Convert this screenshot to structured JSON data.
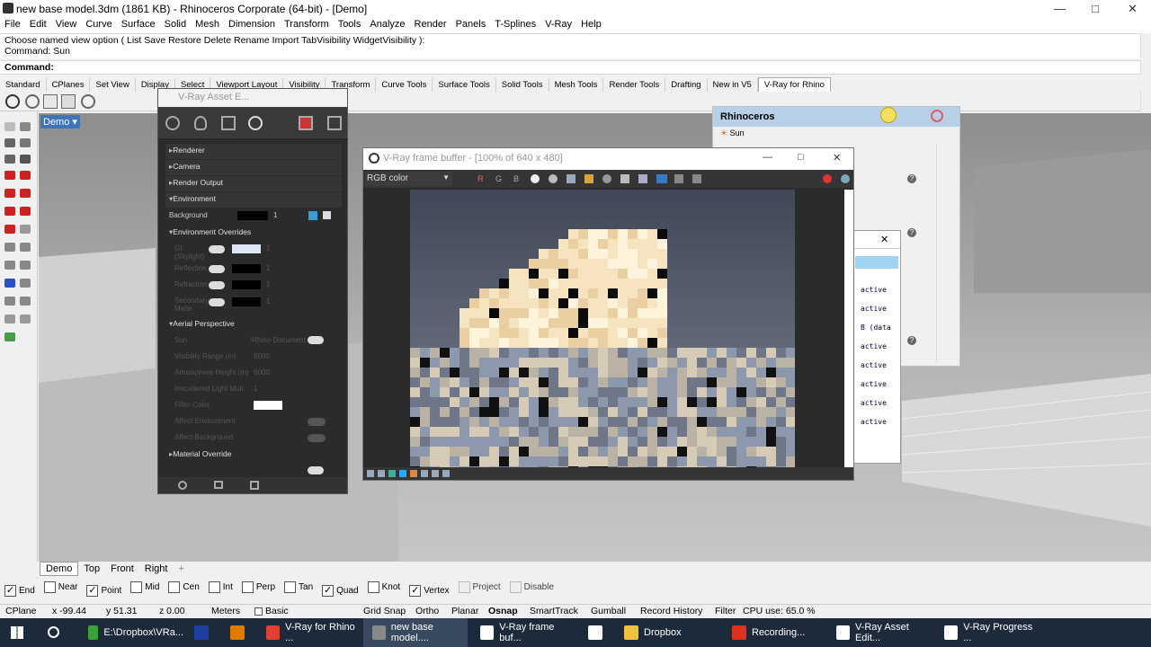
{
  "title": {
    "text": "new base model.3dm (1861 KB) - Rhinoceros Corporate (64-bit) - [Demo]"
  },
  "menu": [
    "File",
    "Edit",
    "View",
    "Curve",
    "Surface",
    "Solid",
    "Mesh",
    "Dimension",
    "Transform",
    "Tools",
    "Analyze",
    "Render",
    "Panels",
    "T-Splines",
    "V-Ray",
    "Help"
  ],
  "command": {
    "history1": "Choose named view option ( List  Save  Restore  Delete  Rename  Import  TabVisibility  WidgetVisibility ):",
    "history2": "Command: Sun",
    "prompt": "Command:"
  },
  "toolbar_tabs": [
    "Standard",
    "CPlanes",
    "Set View",
    "Display",
    "Select",
    "Viewport Layout",
    "Visibility",
    "Transform",
    "Curve Tools",
    "Surface Tools",
    "Solid Tools",
    "Mesh Tools",
    "Render Tools",
    "Drafting",
    "New in V5",
    "V-Ray for Rhino"
  ],
  "viewport": {
    "name": "Demo",
    "tabs": [
      "Demo",
      "Top",
      "Front",
      "Right"
    ],
    "add": "+"
  },
  "asset_editor": {
    "title": "V-Ray Asset E...",
    "sections": [
      "Renderer",
      "Camera",
      "Render Output",
      "Environment"
    ],
    "background_label": "Background",
    "background_mult": "1",
    "env_overrides": "Environment Overrides",
    "overrides": [
      {
        "label": "GI (Skylight)",
        "v": "1"
      },
      {
        "label": "Reflection",
        "v": "1"
      },
      {
        "label": "Refraction",
        "v": "1"
      },
      {
        "label": "Secondary Matte",
        "v": "1"
      }
    ],
    "aerial": "Aerial Perspective",
    "sun_label": "Sun",
    "sun_value": "/Rhino Document Sun",
    "aerial_props": [
      {
        "label": "Visibility Range (m)",
        "v": "6000"
      },
      {
        "label": "Atmosphere Height (m)",
        "v": "6000"
      },
      {
        "label": "Inscattered Light Mult.",
        "v": "1"
      },
      {
        "label": "Filter Color",
        "v": ""
      },
      {
        "label": "Affect Environment",
        "v": ""
      },
      {
        "label": "Affect Background",
        "v": ""
      }
    ],
    "material_override": "Material Override"
  },
  "frame_buffer": {
    "title": "V-Ray frame buffer - [100% of 640 x 480]",
    "channel": "RGB color",
    "toolbar_letters": [
      "R",
      "G",
      "B"
    ]
  },
  "rhino_panel": {
    "title": "Rhinoceros",
    "tab": "Sun"
  },
  "progress": {
    "lines": [
      "active",
      "active",
      "B (data",
      "active",
      "active",
      "active",
      "active",
      "active"
    ]
  },
  "osnap": [
    {
      "label": "End",
      "on": true
    },
    {
      "label": "Near",
      "on": false
    },
    {
      "label": "Point",
      "on": true
    },
    {
      "label": "Mid",
      "on": false
    },
    {
      "label": "Cen",
      "on": false
    },
    {
      "label": "Int",
      "on": false
    },
    {
      "label": "Perp",
      "on": false
    },
    {
      "label": "Tan",
      "on": false
    },
    {
      "label": "Quad",
      "on": true
    },
    {
      "label": "Knot",
      "on": false
    },
    {
      "label": "Vertex",
      "on": true
    },
    {
      "label": "Project",
      "on": false
    },
    {
      "label": "Disable",
      "on": false
    }
  ],
  "status": {
    "cplane": "CPlane",
    "x": "x -99.44",
    "y": "y 51.31",
    "z": "z 0.00",
    "units": "Meters",
    "layer": "Basic",
    "items": [
      "Grid Snap",
      "Ortho",
      "Planar",
      "Osnap",
      "SmartTrack",
      "Gumball",
      "Record History",
      "Filter"
    ],
    "cpu": "CPU use: 65.0 %"
  },
  "taskbar": [
    {
      "label": "E:\\Dropbox\\VRa...",
      "color": "#3aa03a"
    },
    {
      "label": "",
      "color": "#1f3fa0"
    },
    {
      "label": "",
      "color": "#e07b00"
    },
    {
      "label": "V-Ray for Rhino ...",
      "color": "#e04030"
    },
    {
      "label": "new base model....",
      "color": "#888"
    },
    {
      "label": "V-Ray frame buf...",
      "color": "#fff"
    },
    {
      "label": "",
      "color": "#fff"
    },
    {
      "label": "Dropbox",
      "color": "#f0c040"
    },
    {
      "label": "Recording...",
      "color": "#e03020"
    },
    {
      "label": "V-Ray Asset Edit...",
      "color": "#fff"
    },
    {
      "label": "V-Ray Progress ...",
      "color": "#fff"
    }
  ]
}
